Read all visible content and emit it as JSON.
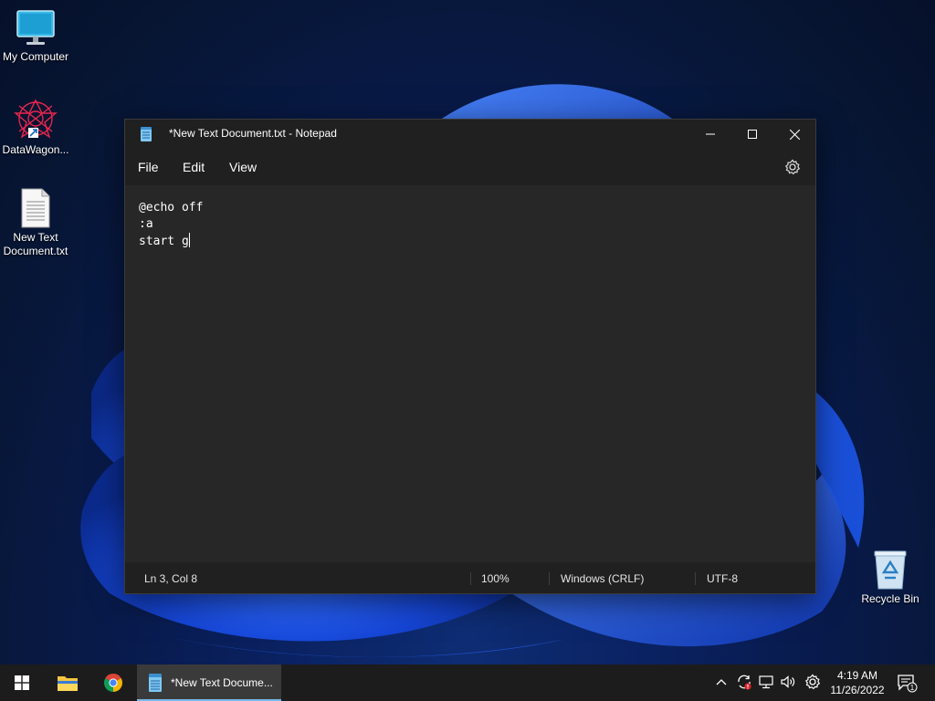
{
  "desktop": {
    "icons": [
      {
        "label": "My Computer"
      },
      {
        "label": "DataWagon..."
      },
      {
        "label": "New Text Document.txt"
      },
      {
        "label": "Recycle Bin"
      }
    ]
  },
  "window": {
    "title": "*New Text Document.txt - Notepad",
    "menu": {
      "file": "File",
      "edit": "Edit",
      "view": "View"
    },
    "content": {
      "lines": [
        "@echo off",
        ":a",
        "start g"
      ]
    },
    "status": {
      "position": "Ln 3, Col 8",
      "zoom": "100%",
      "line_ending": "Windows (CRLF)",
      "encoding": "UTF-8"
    }
  },
  "taskbar": {
    "task_label": "*New Text Docume...",
    "time": "4:19 AM",
    "date": "11/26/2022",
    "notification_count": "1"
  },
  "colors": {
    "window_bg": "#272727",
    "titlebar_bg": "#202020",
    "taskbar_bg": "#1c1c1c",
    "active_underline": "#76b9ed"
  }
}
